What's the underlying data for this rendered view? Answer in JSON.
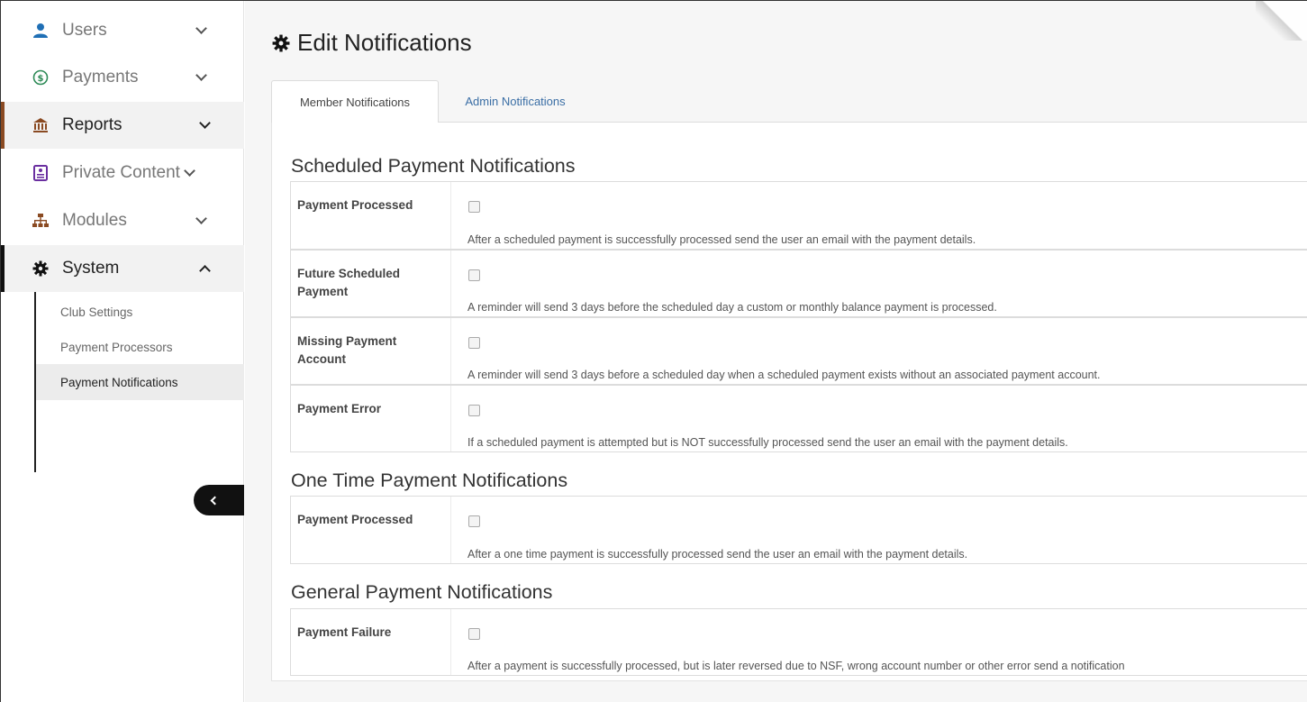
{
  "sidebar": {
    "items": [
      {
        "label": "Users",
        "icon": "user-icon"
      },
      {
        "label": "Payments",
        "icon": "dollar-circle-icon"
      },
      {
        "label": "Reports",
        "icon": "bank-icon"
      },
      {
        "label": "Private Content",
        "icon": "id-card-icon"
      },
      {
        "label": "Modules",
        "icon": "sitemap-icon"
      },
      {
        "label": "System",
        "icon": "gear-icon"
      }
    ],
    "subitems": [
      {
        "label": "Club Settings"
      },
      {
        "label": "Payment Processors"
      },
      {
        "label": "Payment Notifications"
      }
    ]
  },
  "page": {
    "title": "Edit Notifications"
  },
  "tabs": [
    {
      "label": "Member Notifications"
    },
    {
      "label": "Admin Notifications"
    }
  ],
  "sections": [
    {
      "title": "Scheduled Payment Notifications",
      "rows": [
        {
          "label": "Payment Processed",
          "desc": "After a scheduled payment is successfully processed send the user an email with the payment details.",
          "checked": false
        },
        {
          "label": "Future Scheduled Payment",
          "desc": "A reminder will send 3 days before the scheduled day a custom or monthly balance payment is processed.",
          "checked": false
        },
        {
          "label": "Missing Payment Account",
          "desc": "A reminder will send 3 days before a scheduled day when a scheduled payment exists without an associated payment account.",
          "checked": false
        },
        {
          "label": "Payment Error",
          "desc": "If a scheduled payment is attempted but is NOT successfully processed send the user an email with the payment details.",
          "checked": false
        }
      ]
    },
    {
      "title": "One Time Payment Notifications",
      "rows": [
        {
          "label": "Payment Processed",
          "desc": "After a one time payment is successfully processed send the user an email with the payment details.",
          "checked": false
        }
      ]
    },
    {
      "title": "General Payment Notifications",
      "rows": [
        {
          "label": "Payment Failure",
          "desc": "After a payment is successfully processed, but is later reversed due to NSF, wrong account number or other error send a notification",
          "checked": false
        }
      ]
    }
  ],
  "colors": {
    "reports_accent": "#8a4a22",
    "user_icon": "#1f6fb5",
    "payments_icon": "#2e8b57",
    "reports_icon": "#8a4a22",
    "private_icon": "#6a2fa0",
    "modules_icon": "#8a4a22",
    "link": "#3a6ea5"
  }
}
